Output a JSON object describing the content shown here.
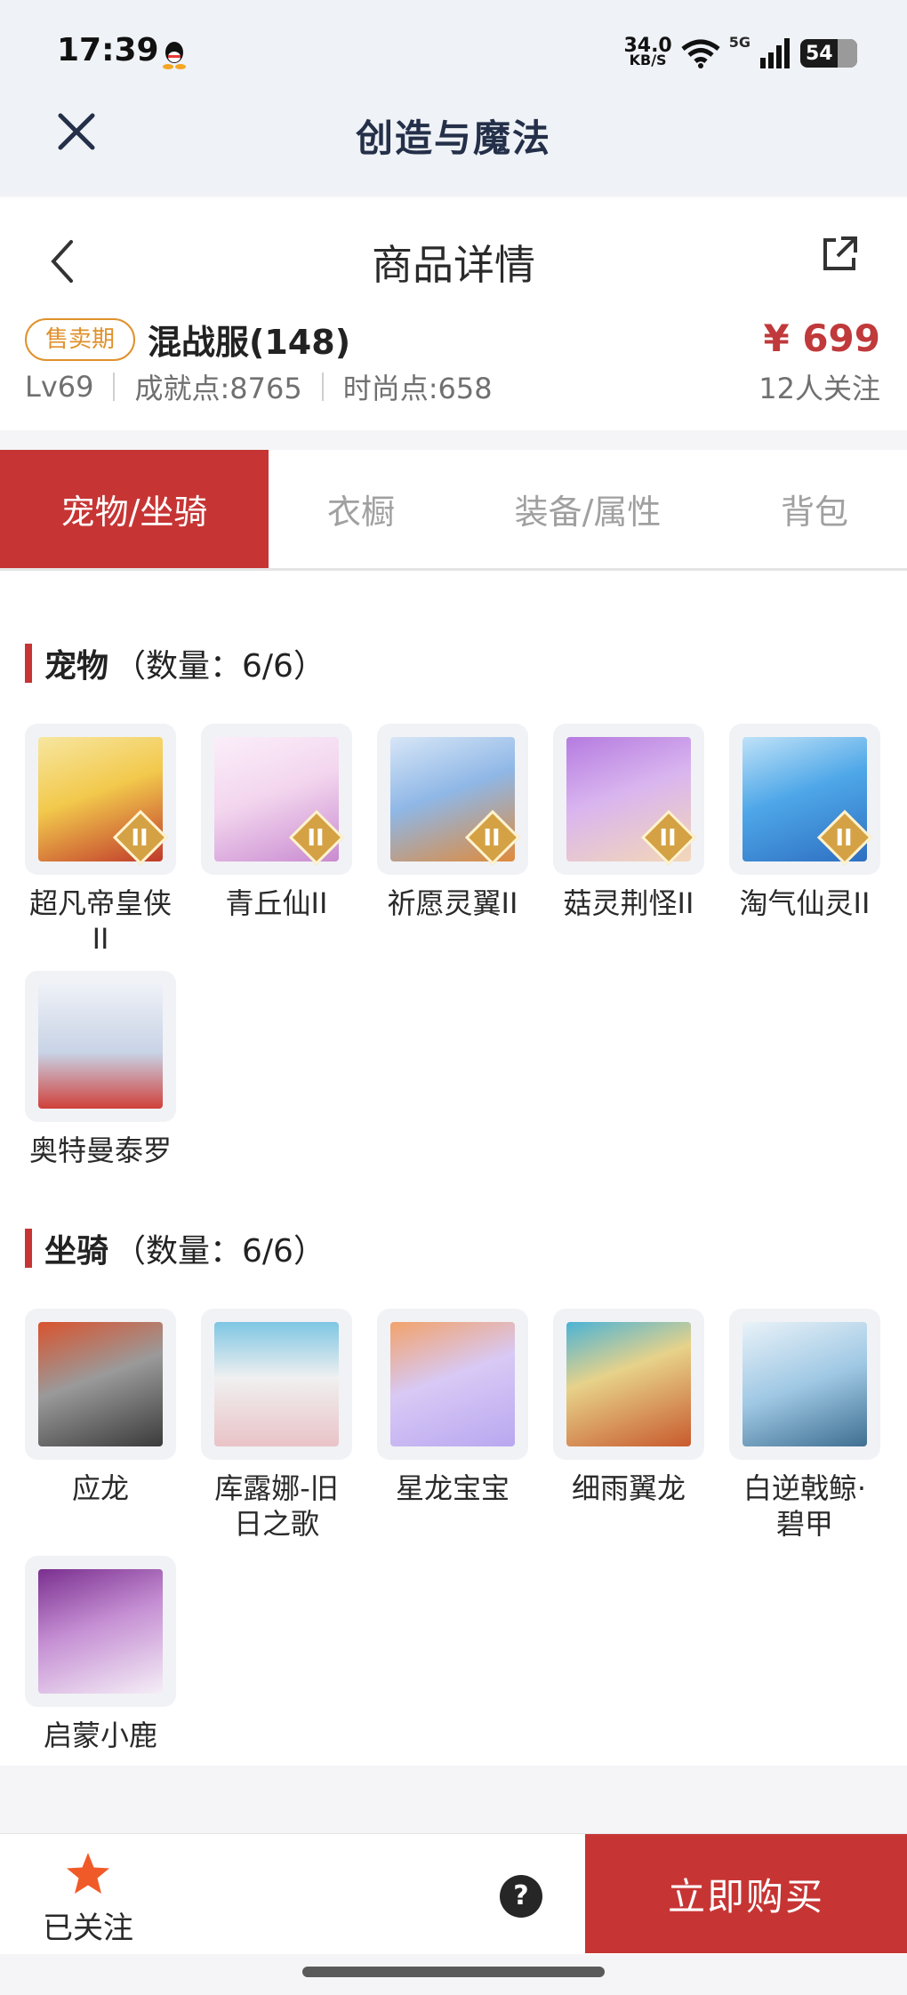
{
  "status_bar": {
    "time": "17:39",
    "net_speed_value": "34.0",
    "net_speed_unit": "KB/S",
    "network": "5G",
    "battery": "54"
  },
  "app": {
    "title": "创造与魔法"
  },
  "header": {
    "page_title": "商品详情",
    "sale_badge": "售卖期",
    "server_name": "混战服(148)",
    "price": "¥ 699",
    "level": "Lv69",
    "achievement": "成就点:8765",
    "fashion": "时尚点:658",
    "followers": "12人关注"
  },
  "tabs": [
    {
      "label": "宠物/坐骑",
      "active": true
    },
    {
      "label": "衣橱",
      "active": false
    },
    {
      "label": "装备/属性",
      "active": false
    },
    {
      "label": "背包",
      "active": false
    }
  ],
  "pets": {
    "title": "宠物",
    "count": "（数量：6/6）",
    "items": [
      {
        "label": "超凡帝皇侠II",
        "tier": "II",
        "color_a": "#f2c94c",
        "color_b": "#c0392b"
      },
      {
        "label": "青丘仙II",
        "tier": "II",
        "color_a": "#f3d6ee",
        "color_b": "#c98bd1"
      },
      {
        "label": "祈愿灵翼II",
        "tier": "II",
        "color_a": "#8fb7e6",
        "color_b": "#e08a3b"
      },
      {
        "label": "菇灵荆怪II",
        "tier": "II",
        "color_a": "#b57be0",
        "color_b": "#f3d7b8"
      },
      {
        "label": "淘气仙灵II",
        "tier": "II",
        "color_a": "#4ea7e8",
        "color_b": "#2e6fc2"
      },
      {
        "label": "奥特曼泰罗",
        "tier": "",
        "color_a": "#c8d3e6",
        "color_b": "#d0403a"
      }
    ]
  },
  "mounts": {
    "title": "坐骑",
    "count": "（数量：6/6）",
    "items": [
      {
        "label": "应龙",
        "color_a": "#6d6d6d",
        "color_b": "#d9532e"
      },
      {
        "label": "库露娜-旧日之歌",
        "color_a": "#f0f0f0",
        "color_b": "#7ec6e3"
      },
      {
        "label": "星龙宝宝",
        "color_a": "#b9a7f0",
        "color_b": "#f2a26b"
      },
      {
        "label": "细雨翼龙",
        "color_a": "#c85a2e",
        "color_b": "#4bb3d6"
      },
      {
        "label": "白逆戟鲸·碧甲",
        "color_a": "#9fc8e4",
        "color_b": "#e9f2f8"
      },
      {
        "label": "启蒙小鹿",
        "color_a": "#7a2f8f",
        "color_b": "#f5eef7"
      }
    ]
  },
  "bottom_bar": {
    "follow_label": "已关注",
    "help": "?",
    "buy_label": "立即购买"
  },
  "colors": {
    "accent": "#c63534",
    "badge": "#e0912c",
    "star": "#f05a28"
  }
}
